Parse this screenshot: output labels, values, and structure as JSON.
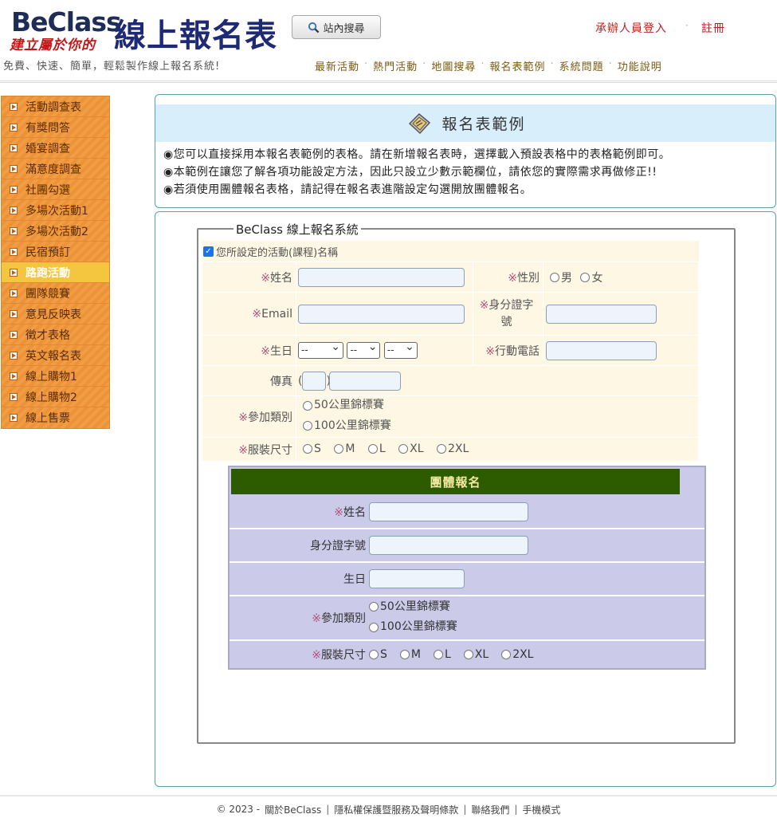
{
  "header": {
    "logo_en": "BeClass",
    "logo_sub": "建立屬於你的",
    "logo_cn": "線上報名表",
    "slogan": "免費、快速、簡單，輕鬆製作線上報名系統!",
    "search_label": "站內搜尋",
    "login_label": "承辦人員登入",
    "register_label": "註冊",
    "nav": [
      "最新活動",
      "熱門活動",
      "地圖搜尋",
      "報名表範例",
      "系統問題",
      "功能說明"
    ]
  },
  "sidebar": {
    "items": [
      "活動調查表",
      "有獎問答",
      "婚宴調查",
      "滿意度調查",
      "社團勾選",
      "多場次活動1",
      "多場次活動2",
      "民宿預訂",
      "路跑活動",
      "團隊競賽",
      "意見反映表",
      "徵才表格",
      "英文報名表",
      "線上購物1",
      "線上購物2",
      "線上售票"
    ],
    "active_index": 8
  },
  "intro": {
    "title": "報名表範例",
    "notes": [
      "◉您可以直接採用本報名表範例的表格。請在新增報名表時，選擇載入預設表格中的表格範例即可。",
      "◉本範例在讓您了解各項功能設定方法，因此只設立少數示範欄位，請依您的實際需求再做修正!!",
      "◉若須使用團體報名表格，請記得在報名表進階設定勾選開放團體報名。"
    ]
  },
  "form": {
    "legend": "BeClass 線上報名系統",
    "activity_name": "您所設定的活動(課程)名稱",
    "required_mark": "※",
    "name_label": "姓名",
    "gender_label": "性別",
    "gender_options": [
      "男",
      "女"
    ],
    "email_label": "Email",
    "id_label_1": "身分證字",
    "id_label_2": "號",
    "birthday_label": "生日",
    "birthday_placeholder": "--",
    "mobile_label": "行動電話",
    "fax_label": "傳真",
    "category_label": "參加類別",
    "category_options": [
      "50公里錦標賽",
      "100公里錦標賽"
    ],
    "size_label": "服裝尺寸",
    "size_options": [
      "S",
      "M",
      "L",
      "XL",
      "2XL"
    ]
  },
  "group": {
    "title": "團體報名",
    "name_label": "姓名",
    "id_label": "身分證字號",
    "birthday_label": "生日",
    "category_label": "參加類別",
    "size_label": "服裝尺寸"
  },
  "footer": {
    "copyright": "© 2023 -",
    "links": [
      "關於BeClass",
      "隱私權保護暨服務及聲明條款",
      "聯絡我們",
      "手機模式"
    ]
  },
  "colors": {
    "sidebar_orange": "#ef9a3e",
    "sidebar_active": "#f4c63f",
    "group_header": "#2d5c00",
    "group_bg": "#cbcae9",
    "form_bg": "#fdf7e4",
    "title_bg": "#d9eefb",
    "required": "#b2547c"
  }
}
